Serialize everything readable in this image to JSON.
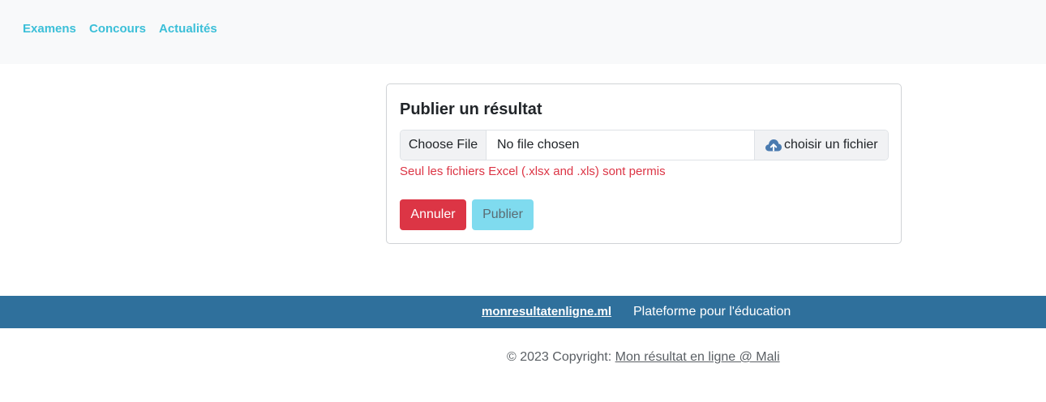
{
  "nav": {
    "items": [
      {
        "label": "Examens"
      },
      {
        "label": "Concours"
      },
      {
        "label": "Actualités"
      }
    ],
    "link_color": "#3bbfd8"
  },
  "card": {
    "title": "Publier un résultat",
    "file_input": {
      "button_label": "Choose File",
      "status": "No file chosen",
      "addon_icon": "cloud-upload-icon",
      "addon_label": "choisir un fichier"
    },
    "error_message": "Seul les fichiers Excel (.xlsx and .xls) sont permis",
    "actions": {
      "cancel_label": "Annuler",
      "publish_label": "Publier"
    }
  },
  "footer": {
    "site_name": "monresultatenligne.ml",
    "tagline": "Plateforme pour l'éducation",
    "copyright_prefix": "© 2023 Copyright: ",
    "copyright_link": "Mon résultat en ligne @ Mali",
    "band_color": "#2f709c"
  },
  "colors": {
    "danger": "#dc3545",
    "info_disabled": "#7fdbef"
  }
}
